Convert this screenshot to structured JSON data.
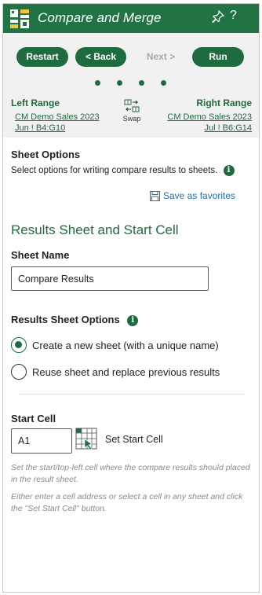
{
  "header": {
    "title": "Compare and Merge",
    "logo_icon": "app-grid-logo",
    "pin_icon": "pin-icon",
    "help_label": "?"
  },
  "nav": {
    "restart_label": "Restart",
    "back_label": "< Back",
    "next_label": "Next >",
    "run_label": "Run",
    "step_count": 4
  },
  "ranges": {
    "left_label": "Left Range",
    "left_value": "CM Demo Sales 2023 Jun ! B4:G10",
    "right_label": "Right Range",
    "right_value": "CM Demo Sales 2023 Jul ! B6:G14",
    "swap_label": "Swap"
  },
  "sheet_options": {
    "heading": "Sheet Options",
    "description": "Select options for writing compare results to sheets.",
    "info_glyph": "i",
    "save_favorites_label": "Save as favorites"
  },
  "results": {
    "section_title": "Results Sheet and Start Cell",
    "sheet_name_label": "Sheet Name",
    "sheet_name_value": "Compare Results",
    "options_label": "Results Sheet Options",
    "option_new": "Create a new sheet (with a unique name)",
    "option_reuse": "Reuse sheet and replace previous results",
    "selected_option": "new"
  },
  "start_cell": {
    "label": "Start Cell",
    "value": "A1",
    "button_label": "Set Start Cell",
    "hint_1": "Set the start/top-left cell where the compare results should placed in the result sheet.",
    "hint_2": "Either enter a cell address or select a cell in any sheet and click the \"Set Start Cell\" button."
  },
  "colors": {
    "brand_green": "#217346",
    "button_green": "#1e6b3f",
    "link_blue": "#1f6fb2",
    "disabled_gray": "#a9a9a9"
  }
}
